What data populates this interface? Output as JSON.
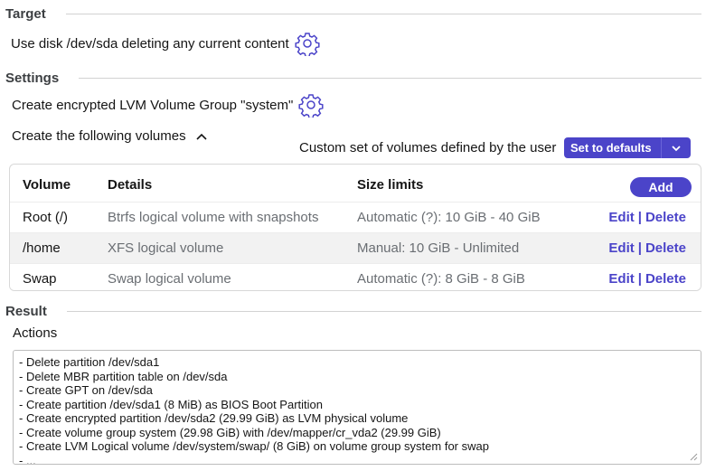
{
  "target": {
    "heading": "Target",
    "text": "Use disk /dev/sda deleting any current content",
    "icon": "gear-icon"
  },
  "settings": {
    "heading": "Settings",
    "encrypt_text": "Create encrypted LVM Volume Group \"system\"",
    "volumes_text": "Create the following volumes",
    "custom_label": "Custom set of volumes defined by the user",
    "defaults_button": "Set to defaults",
    "add_button": "Add",
    "table": {
      "headers": [
        "Volume",
        "Details",
        "Size limits"
      ],
      "rows": [
        {
          "volume": "Root (/)",
          "details": "Btrfs logical volume with snapshots",
          "size": "Automatic (?): 10 GiB - 40 GiB",
          "edit": "Edit",
          "delete": "Delete"
        },
        {
          "volume": "/home",
          "details": "XFS logical volume",
          "size": "Manual: 10 GiB - Unlimited",
          "edit": "Edit",
          "delete": "Delete"
        },
        {
          "volume": "Swap",
          "details": "Swap logical volume",
          "size": "Automatic (?): 8 GiB - 8 GiB",
          "edit": "Edit",
          "delete": "Delete"
        }
      ],
      "separator": "|"
    }
  },
  "result": {
    "heading": "Result",
    "actions_label": "Actions",
    "actions": [
      "- Delete partition /dev/sda1",
      "- Delete MBR partition table on /dev/sda",
      "- Create GPT on /dev/sda",
      "- Create partition /dev/sda1 (8 MiB) as BIOS Boot Partition",
      "- Create encrypted partition /dev/sda2 (29.99 GiB) as LVM physical volume",
      "- Create volume group system (29.98 GiB) with /dev/mapper/cr_vda2 (29.99 GiB)",
      "- Create LVM Logical volume /dev/system/swap/ (8 GiB) on volume group system for swap",
      "- ..."
    ]
  },
  "colors": {
    "accent": "#4b44c9",
    "muted_text": "#6a6e73",
    "row_stripe": "#f2f2f2"
  }
}
